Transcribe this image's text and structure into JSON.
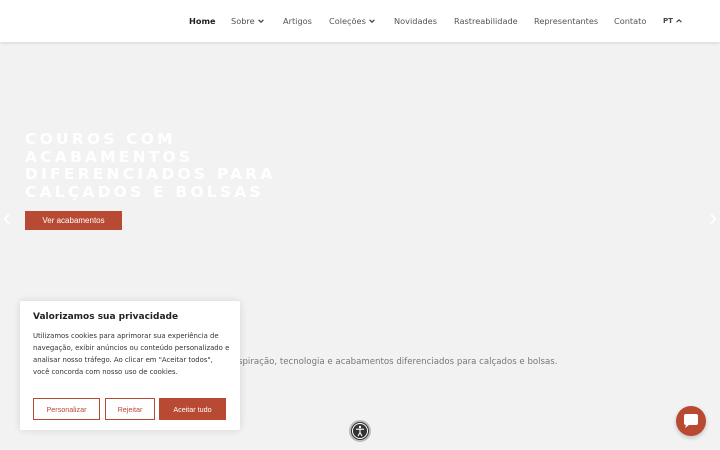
{
  "nav": {
    "items": [
      {
        "label": "Home",
        "active": true
      },
      {
        "label": "Sobre",
        "dropdown": true
      },
      {
        "label": "Artigos"
      },
      {
        "label": "Coleções",
        "dropdown": true
      },
      {
        "label": "Novidades"
      },
      {
        "label": "Rastreabilidade"
      },
      {
        "label": "Representantes"
      },
      {
        "label": "Contato"
      }
    ],
    "language": "PT"
  },
  "hero": {
    "title_lines": [
      "COUROS COM",
      "ACABAMENTOS",
      "DIFERENCIADOS PARA",
      "CALÇADOS E BOLSAS"
    ],
    "button_label": "Ver acabamentos",
    "description_partial": "spiração, tecnologia e acabamentos diferenciados para calçados e bolsas."
  },
  "cookie": {
    "title": "Valorizamos sua privacidade",
    "text": "Utilizamos cookies para aprimorar sua experiência de navegação, exibir anúncios ou conteúdo personalizado e analisar nosso tráfego. Ao clicar em \"Aceitar todos\", você concorda com nosso uso de cookies.",
    "buttons": {
      "customize": "Personalizar",
      "reject": "Rejeitar",
      "accept": "Aceitar tudo"
    }
  },
  "colors": {
    "accent": "#b84a33",
    "header_bg": "#ffffff",
    "hero_bg": "#f2f2f2"
  },
  "icons": {
    "dropdown": "chevron-down-icon",
    "language": "chevron-up-icon",
    "slider_prev": "chevron-left-icon",
    "slider_next": "chevron-right-icon",
    "accessibility": "accessibility-icon",
    "chat": "chat-icon"
  }
}
